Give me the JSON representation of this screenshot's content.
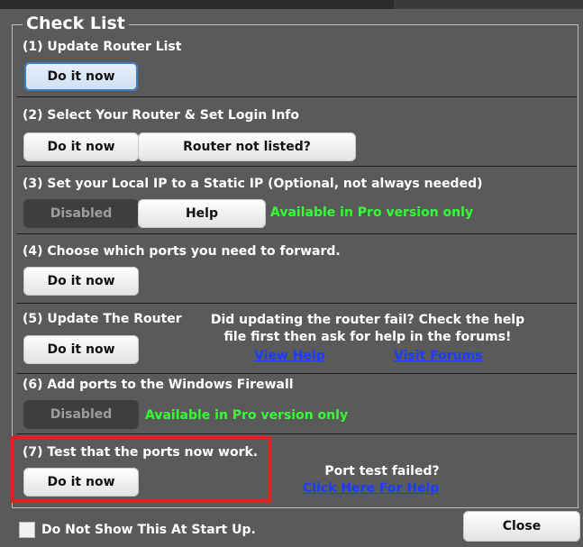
{
  "window": {
    "section_title": "Check List"
  },
  "steps": [
    {
      "title": "(1) Update Router List",
      "buttons": [
        "Do it now"
      ]
    },
    {
      "title": "(2) Select Your Router & Set Login Info",
      "buttons": [
        "Do it now",
        "Router not listed?"
      ]
    },
    {
      "title": "(3) Set your Local IP to a Static IP (Optional, not always needed)",
      "buttons": [
        "Disabled",
        "Help"
      ],
      "note": "Available in Pro version only"
    },
    {
      "title": "(4) Choose which ports you need to forward.",
      "buttons": [
        "Do it now"
      ]
    },
    {
      "title": "(5) Update The Router",
      "buttons": [
        "Do it now"
      ],
      "help_text": "Did updating the router fail? Check the help file first then ask for help in the forums!",
      "links": [
        "View Help",
        "Visit Forums"
      ]
    },
    {
      "title": "(6) Add ports to the Windows Firewall",
      "buttons": [
        "Disabled"
      ],
      "note": "Available in Pro version only"
    },
    {
      "title": "(7) Test that the ports now work.",
      "buttons": [
        "Do it now"
      ],
      "help_text": "Port test failed?",
      "links": [
        "Click Here For Help"
      ]
    }
  ],
  "footer": {
    "checkbox_label": "Do Not Show This At Start Up.",
    "checkbox_checked": false,
    "close_label": "Close"
  },
  "colors": {
    "background": "#5a5a5a",
    "pro_note": "#33ff33",
    "link": "#1a3cff",
    "highlight": "#e02020"
  }
}
